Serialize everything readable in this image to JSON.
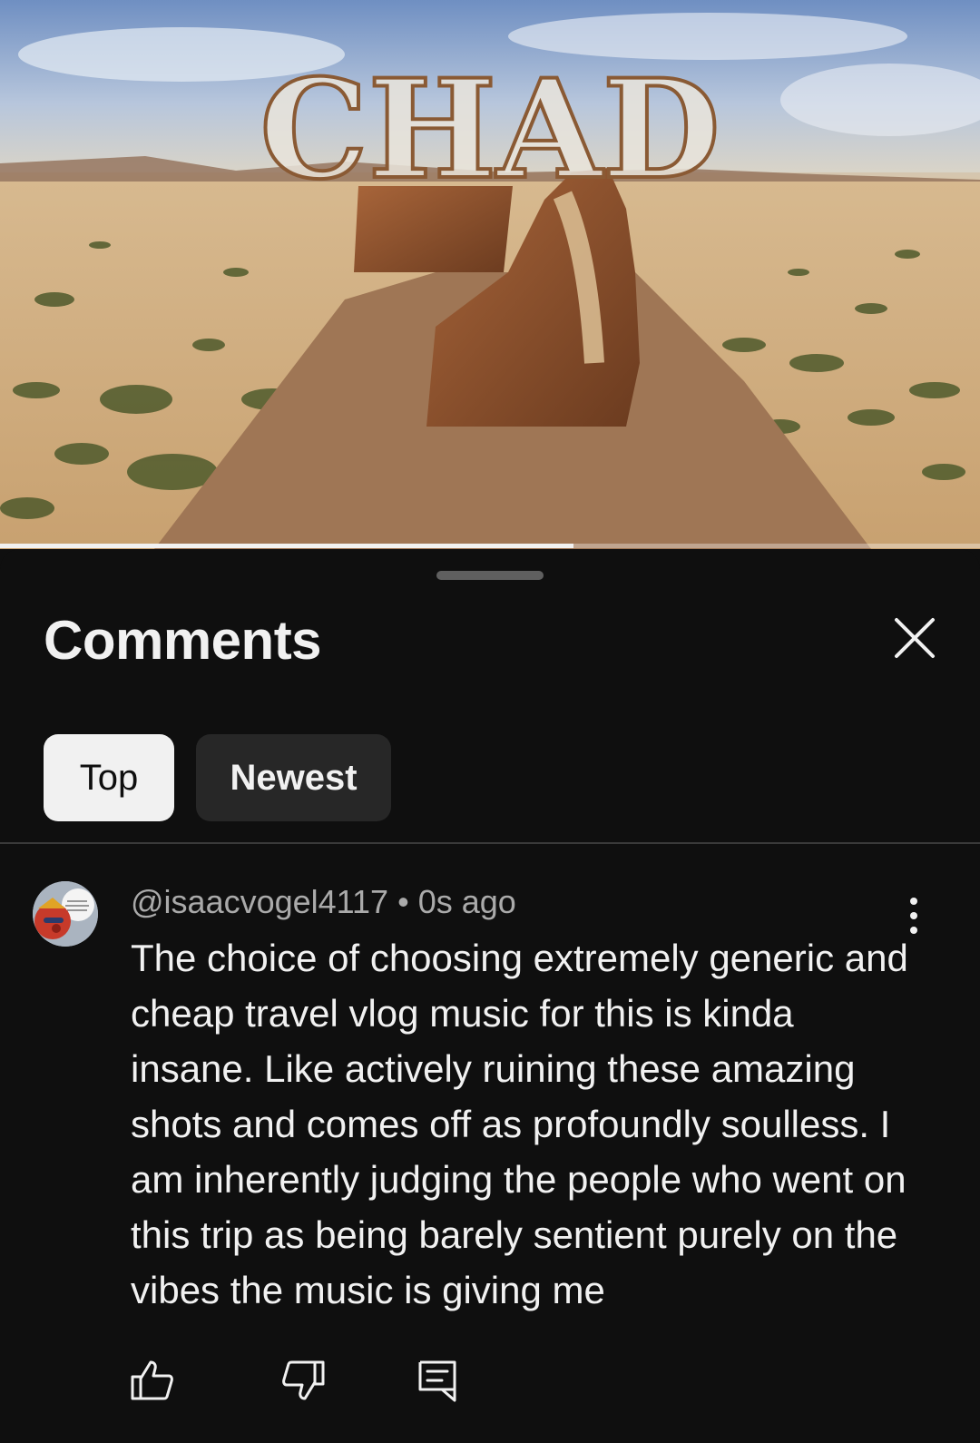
{
  "video": {
    "title_overlay": "CHAD",
    "progress": 0.585
  },
  "comments_panel": {
    "title": "Comments",
    "close_icon": "close-icon",
    "sort_chips": [
      {
        "label": "Top",
        "selected": true
      },
      {
        "label": "Newest",
        "selected": false
      }
    ]
  },
  "comment": {
    "author": "@isaacvogel4117",
    "separator": "•",
    "time": "0s ago",
    "text": "The choice of choosing extremely generic and cheap travel vlog music for this is kinda insane. Like actively ruining these amazing shots and comes off as profoundly soulless. I am inherently judging the people who went on this trip as being barely sentient purely on the vibes the music is giving me",
    "actions": {
      "like_icon": "thumbs-up-icon",
      "dislike_icon": "thumbs-down-icon",
      "reply_icon": "reply-comment-icon",
      "menu_icon": "more-vert-icon"
    }
  },
  "colors": {
    "background": "#0f0f0f",
    "text_primary": "#f1f1f1",
    "text_secondary": "#aaaaaa",
    "chip_selected_bg": "#f1f1f1",
    "chip_unselected_bg": "#272727"
  }
}
